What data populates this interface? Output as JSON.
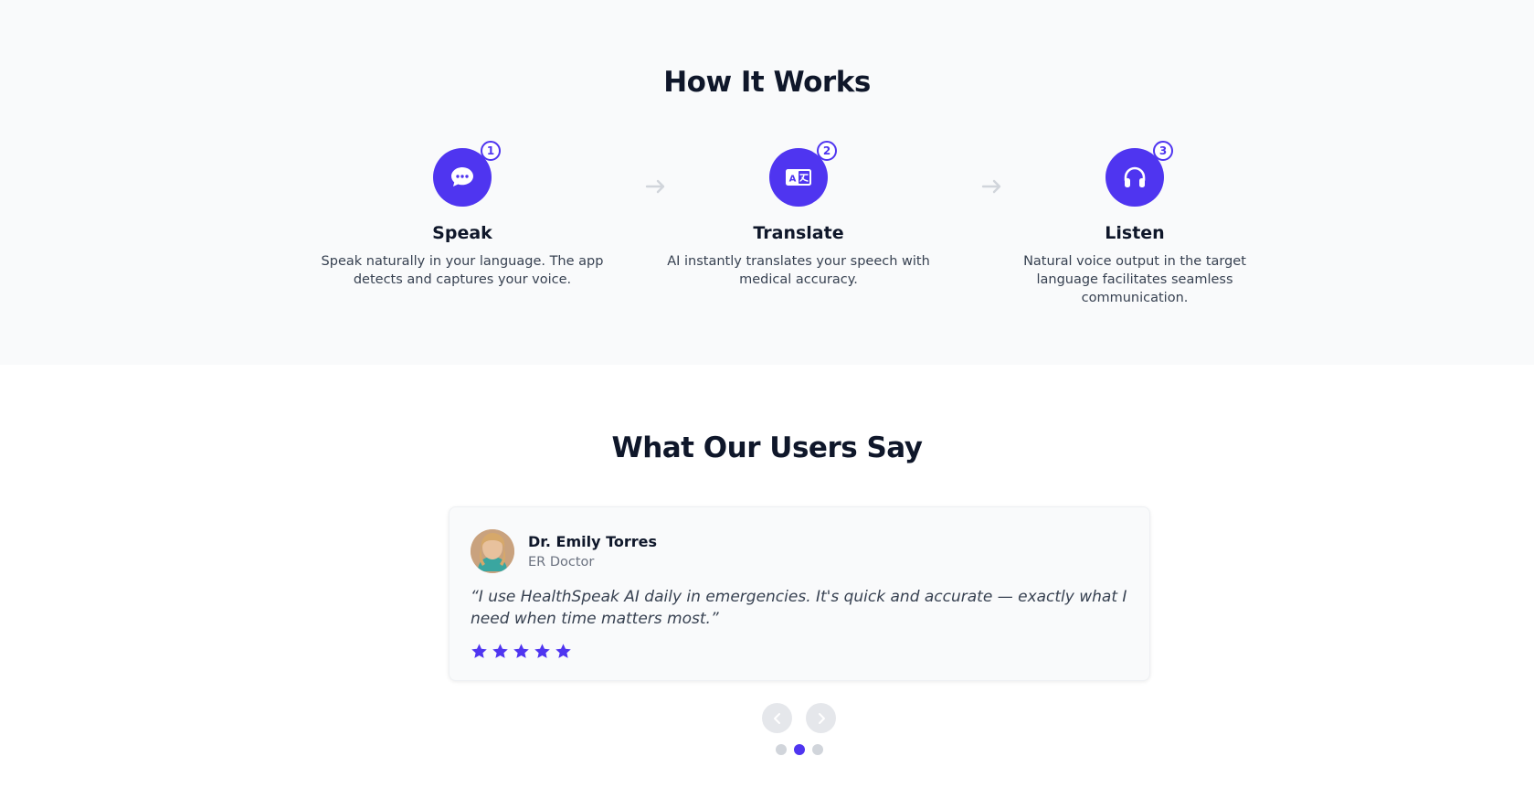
{
  "how_it_works": {
    "title": "How It Works",
    "steps": [
      {
        "number": "1",
        "title": "Speak",
        "description": "Speak naturally in your language. The app detects and captures your voice.",
        "icon": "chat-bubble-icon"
      },
      {
        "number": "2",
        "title": "Translate",
        "description": "AI instantly translates your speech with medical accuracy.",
        "icon": "translate-icon"
      },
      {
        "number": "3",
        "title": "Listen",
        "description": "Natural voice output in the target language facilitates seamless communication.",
        "icon": "headphones-icon"
      }
    ]
  },
  "testimonials": {
    "title": "What Our Users Say",
    "current": {
      "name": "Dr. Emily Torres",
      "role": "ER Doctor",
      "quote": "“I use HealthSpeak AI daily in emergencies. It's quick and accurate — exactly what I need when time matters most.”",
      "rating": 5
    },
    "active_dot": 2,
    "dot_count": 3
  },
  "colors": {
    "accent": "#4f35f0",
    "section_bg": "#f9fafb",
    "heading": "#0f172a",
    "text": "#374151",
    "muted": "#6b7280"
  }
}
